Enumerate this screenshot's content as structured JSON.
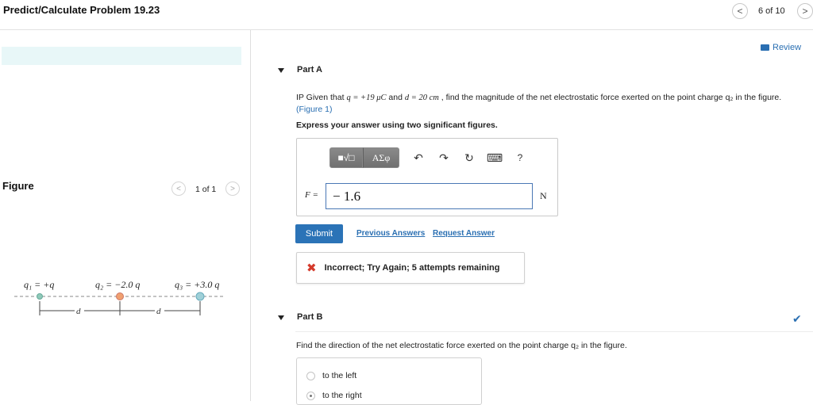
{
  "header": {
    "title": "Predict/Calculate Problem 19.23",
    "page_indicator": "6 of 10",
    "prev_glyph": "<",
    "next_glyph": ">"
  },
  "review": {
    "label": "Review"
  },
  "figure": {
    "label": "Figure",
    "pager": "1 of 1",
    "charges": {
      "q1": "q₁ = +q",
      "q2": "q₂ = −2.0 q",
      "q3": "q₃ = +3.0 q"
    },
    "distance_label": "d",
    "colors": {
      "q1": "#8fc9b9",
      "q2": "#f0a070",
      "q3": "#9fd0d8"
    }
  },
  "part_a": {
    "title": "Part A",
    "question_prefix": "IP Given that ",
    "q_value": "q = +19 μC",
    "and_text": " and ",
    "d_value": "d = 20 cm",
    "question_suffix": " , find the magnitude of the net electrostatic force exerted on the point charge q₂ in the figure. ",
    "figure_link": "(Figure 1)",
    "instructions": "Express your answer using two significant figures.",
    "toolbar": {
      "template_glyph": "■√□",
      "greek_glyph": "AΣφ",
      "undo_glyph": "↶",
      "redo_glyph": "↷",
      "reset_glyph": "↻",
      "keyboard_glyph": "⌨",
      "help_glyph": "?"
    },
    "input_label": "F =",
    "answer_value": "− 1.6",
    "unit": "N",
    "submit_label": "Submit",
    "previous_answers": "Previous Answers",
    "request_answer": "Request Answer",
    "feedback_icon": "✖",
    "feedback": "Incorrect; Try Again; 5 attempts remaining"
  },
  "part_b": {
    "title": "Part B",
    "question": "Find the direction of the net electrostatic force exerted on the point charge q₂ in the figure.",
    "choices": [
      "to the left",
      "to the right"
    ],
    "check_glyph": "✔"
  }
}
